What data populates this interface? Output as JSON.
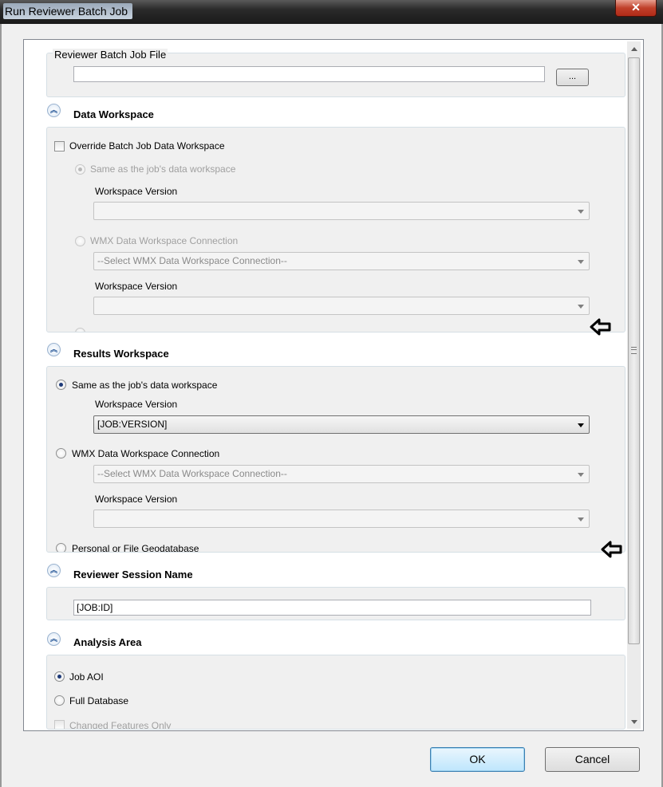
{
  "window": {
    "title": "Run Reviewer Batch Job",
    "close_label": "✕"
  },
  "batch_file": {
    "label": "Reviewer Batch Job File",
    "value": "",
    "browse_label": "..."
  },
  "data_workspace": {
    "header": "Data Workspace",
    "override_label": "Override Batch Job Data Workspace",
    "same_as_job_label": "Same as the job's data workspace",
    "workspace_version_label": "Workspace Version",
    "workspace_version_value": "",
    "wmx_connection_label": "WMX Data Workspace Connection",
    "wmx_connection_value": "--Select WMX Data Workspace Connection--",
    "wmx_version_label": "Workspace Version",
    "wmx_version_value": ""
  },
  "results_workspace": {
    "header": "Results Workspace",
    "same_as_job_label": "Same as the job's data workspace",
    "workspace_version_label": "Workspace Version",
    "workspace_version_value": "[JOB:VERSION]",
    "wmx_connection_label": "WMX Data Workspace Connection",
    "wmx_connection_value": "--Select WMX Data Workspace Connection--",
    "wmx_version_label": "Workspace Version",
    "wmx_version_value": "",
    "geodatabase_label": "Personal or File Geodatabase"
  },
  "session": {
    "header": "Reviewer Session Name",
    "value": "[JOB:ID]"
  },
  "analysis_area": {
    "header": "Analysis Area",
    "job_aoi_label": "Job AOI",
    "full_db_label": "Full Database",
    "changed_only_label": "Changed Features Only"
  },
  "buttons": {
    "ok": "OK",
    "cancel": "Cancel"
  }
}
